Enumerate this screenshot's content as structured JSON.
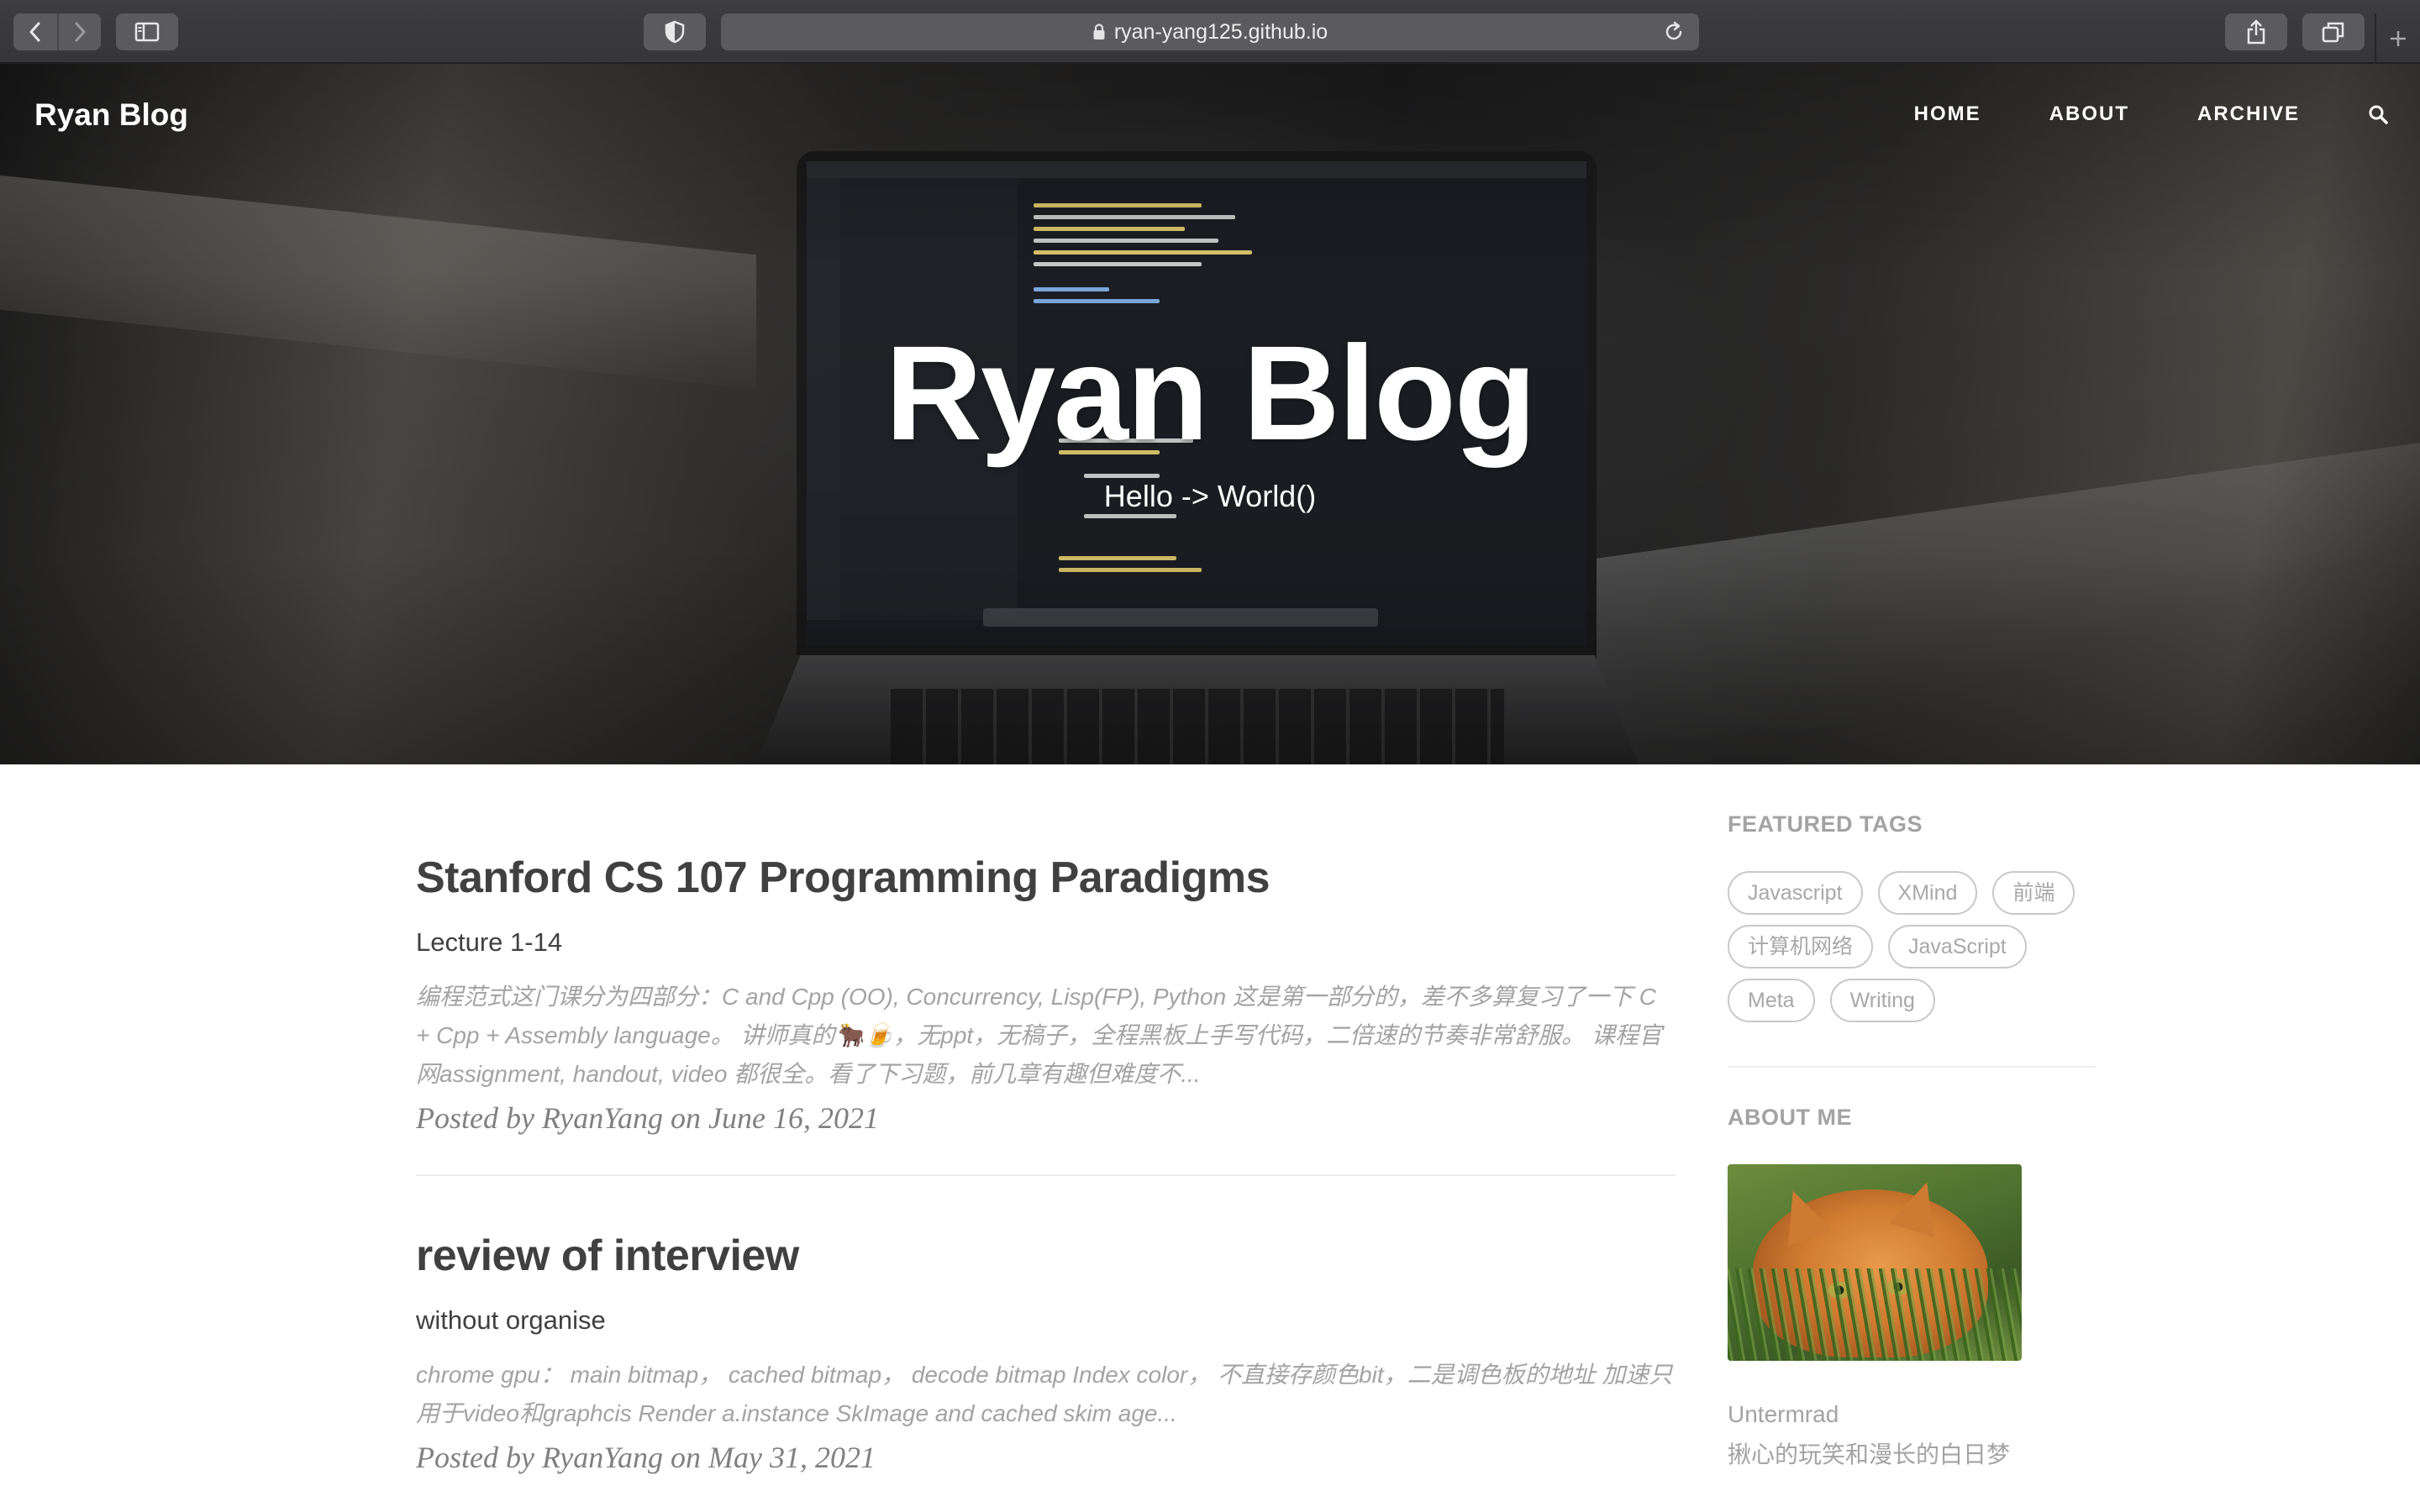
{
  "browser": {
    "url": "ryan-yang125.github.io"
  },
  "site": {
    "logo": "Ryan Blog",
    "nav": [
      "HOME",
      "ABOUT",
      "ARCHIVE"
    ]
  },
  "hero": {
    "title": "Ryan Blog",
    "subtitle": "Hello -> World()"
  },
  "posts": [
    {
      "title": "Stanford CS 107 Programming Paradigms",
      "subtitle": "Lecture 1-14",
      "excerpt": "编程范式这门课分为四部分：C and Cpp (OO), Concurrency, Lisp(FP), Python 这是第一部分的，差不多算复习了一下 C + Cpp + Assembly language。 讲师真的🐂🍺，无ppt，无稿子，全程黑板上手写代码，二倍速的节奏非常舒服。 课程官网assignment, handout, video 都很全。看了下习题，前几章有趣但难度不...",
      "meta": "Posted by RyanYang on June 16, 2021"
    },
    {
      "title": "review of interview",
      "subtitle": "without organise",
      "excerpt": "chrome gpu： main bitmap， cached bitmap， decode bitmap Index color， 不直接存颜色bit，二是调色板的地址 加速只用于video和graphcis Render  a.instance SkImage and cached skim age...",
      "meta": "Posted by RyanYang on May 31, 2021"
    }
  ],
  "sidebar": {
    "featured_tags_heading": "FEATURED TAGS",
    "tags": [
      "Javascript",
      "XMind",
      "前端",
      "计算机网络",
      "JavaScript",
      "Meta",
      "Writing"
    ],
    "about_heading": "ABOUT ME",
    "about_name": "Untermrad",
    "about_bio": "揪心的玩笑和漫长的白日梦"
  },
  "icons": {
    "back": "chevron-left-icon",
    "forward": "chevron-right-icon",
    "sidebar": "sidebar-icon",
    "shield": "shield-icon",
    "lock": "lock-icon",
    "reload": "reload-icon",
    "share": "share-icon",
    "tabs": "tabs-icon",
    "new_tab": "plus-icon",
    "search": "search-icon"
  }
}
